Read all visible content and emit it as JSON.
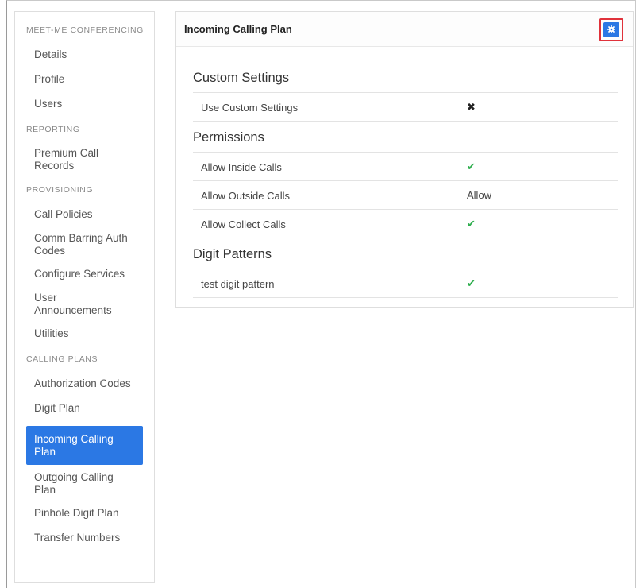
{
  "sidebar": {
    "sections": [
      {
        "header": "MEET-ME CONFERENCING",
        "items": [
          {
            "label": "Details"
          },
          {
            "label": "Profile"
          },
          {
            "label": "Users"
          }
        ]
      },
      {
        "header": "REPORTING",
        "items": [
          {
            "label": "Premium Call Records"
          }
        ]
      },
      {
        "header": "PROVISIONING",
        "items": [
          {
            "label": "Call Policies"
          },
          {
            "label": "Comm Barring Auth Codes"
          },
          {
            "label": "Configure Services"
          },
          {
            "label": "User Announcements"
          },
          {
            "label": "Utilities"
          }
        ]
      },
      {
        "header": "CALLING PLANS",
        "items": [
          {
            "label": "Authorization Codes"
          },
          {
            "label": "Digit Plan"
          },
          {
            "label": "Incoming Calling Plan",
            "active": true
          },
          {
            "label": "Outgoing Calling Plan"
          },
          {
            "label": "Pinhole Digit Plan"
          },
          {
            "label": "Transfer Numbers"
          }
        ]
      }
    ]
  },
  "panel": {
    "title": "Incoming Calling Plan",
    "settings_icon": "gear-icon",
    "highlight_color": "#e0323b",
    "accent_color": "#2b78e4",
    "groups": [
      {
        "title": "Custom Settings",
        "rows": [
          {
            "label": "Use Custom Settings",
            "value": "✖",
            "icon": "cross-icon"
          }
        ]
      },
      {
        "title": "Permissions",
        "rows": [
          {
            "label": "Allow Inside Calls",
            "value": "✔",
            "icon": "check-icon"
          },
          {
            "label": "Allow Outside Calls",
            "value": "Allow"
          },
          {
            "label": "Allow Collect Calls",
            "value": "✔",
            "icon": "check-icon"
          }
        ]
      },
      {
        "title": "Digit Patterns",
        "rows": [
          {
            "label": "test digit pattern",
            "value": "✔",
            "icon": "check-icon"
          }
        ]
      }
    ]
  }
}
